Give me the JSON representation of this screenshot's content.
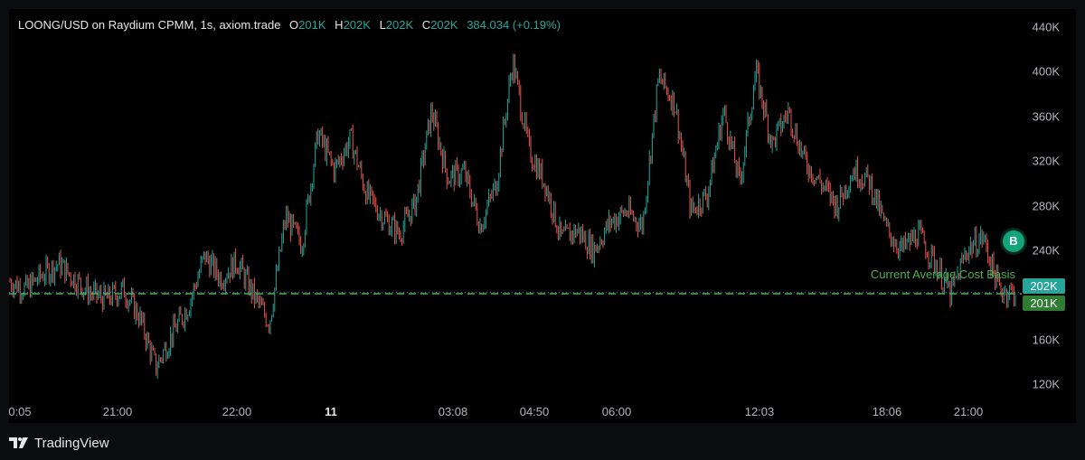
{
  "header": {
    "symbol": "LOONG/USD on Raydium CPMM, 1s, axiom.trade",
    "o_label": "O",
    "o_value": "201K",
    "h_label": "H",
    "h_value": "202K",
    "l_label": "L",
    "l_value": "202K",
    "c_label": "C",
    "c_value": "202K",
    "change": "384.034 (+0.19%)"
  },
  "colors": {
    "up": "#26a69a",
    "down": "#ef5350",
    "cost_line": "#4caf50",
    "background": "#000000"
  },
  "price_tags": {
    "current": "202K",
    "cost_basis": "201K"
  },
  "cost_basis_label": "Current Average Cost Basis",
  "marker": {
    "text": "B"
  },
  "footer": {
    "brand": "TradingView",
    "icon": "tradingview-logo-icon"
  },
  "chart_data": {
    "type": "candlestick",
    "y_ticks": [
      {
        "label": "440K",
        "value": 440000
      },
      {
        "label": "400K",
        "value": 400000
      },
      {
        "label": "360K",
        "value": 360000
      },
      {
        "label": "320K",
        "value": 320000
      },
      {
        "label": "280K",
        "value": 280000
      },
      {
        "label": "240K",
        "value": 240000
      },
      {
        "label": "160K",
        "value": 160000
      },
      {
        "label": "120K",
        "value": 120000
      }
    ],
    "ylim": [
      100000,
      450000
    ],
    "x_ticks": [
      {
        "label": "0:05",
        "bold": false
      },
      {
        "label": "21:00",
        "bold": false
      },
      {
        "label": "22:00",
        "bold": false
      },
      {
        "label": "11",
        "bold": true
      },
      {
        "label": "03:08",
        "bold": false
      },
      {
        "label": "04:50",
        "bold": false
      },
      {
        "label": "06:00",
        "bold": false
      },
      {
        "label": "12:03",
        "bold": false
      },
      {
        "label": "18:06",
        "bold": false
      },
      {
        "label": "21:00",
        "bold": false
      }
    ],
    "cost_basis_value": 201000,
    "current_value": 202000,
    "series": {
      "name": "LOONG/USD",
      "close_path": [
        212000,
        205000,
        218000,
        228000,
        214000,
        201000,
        196000,
        205000,
        180000,
        135000,
        165000,
        190000,
        235000,
        215000,
        230000,
        200000,
        175000,
        270000,
        245000,
        345000,
        312000,
        340000,
        290000,
        270000,
        255000,
        282000,
        365000,
        305000,
        310000,
        262000,
        300000,
        410000,
        330000,
        300000,
        250000,
        258000,
        240000,
        265000,
        275000,
        262000,
        395000,
        372000,
        275000,
        290000,
        365000,
        300000,
        400000,
        335000,
        365000,
        320000,
        300000,
        280000,
        312000,
        302000,
        260000,
        240000,
        255000,
        230000,
        200000,
        240000,
        252000,
        205000,
        202000
      ]
    }
  }
}
